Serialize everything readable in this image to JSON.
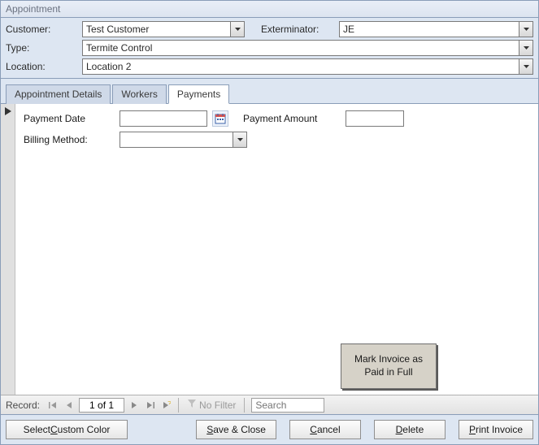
{
  "window": {
    "title": "Appointment"
  },
  "header": {
    "customer_label": "Customer:",
    "customer_value": "Test Customer",
    "exterminator_label": "Exterminator:",
    "exterminator_value": "JE",
    "type_label": "Type:",
    "type_value": "Termite Control",
    "location_label": "Location:",
    "location_value": "Location 2"
  },
  "tabs": {
    "appointment_details": "Appointment Details",
    "workers": "Workers",
    "payments": "Payments",
    "active": "payments"
  },
  "form": {
    "payment_date_label": "Payment Date",
    "payment_date_value": "",
    "payment_amount_label": "Payment Amount",
    "payment_amount_value": "",
    "billing_method_label": "Billing Method:",
    "billing_method_value": "",
    "mark_paid_button": "Mark Invoice as Paid in Full"
  },
  "recordnav": {
    "label": "Record:",
    "counter": "1 of 1",
    "no_filter": "No Filter",
    "search_placeholder": "Search"
  },
  "footer": {
    "select_color_prefix": "Select ",
    "select_color_ul": "C",
    "select_color_suffix": "ustom Color",
    "save_ul": "S",
    "save_suffix": "ave & Close",
    "cancel_ul": "C",
    "cancel_suffix": "ancel",
    "delete_ul": "D",
    "delete_suffix": "elete",
    "print_ul": "P",
    "print_suffix": "rint Invoice"
  }
}
